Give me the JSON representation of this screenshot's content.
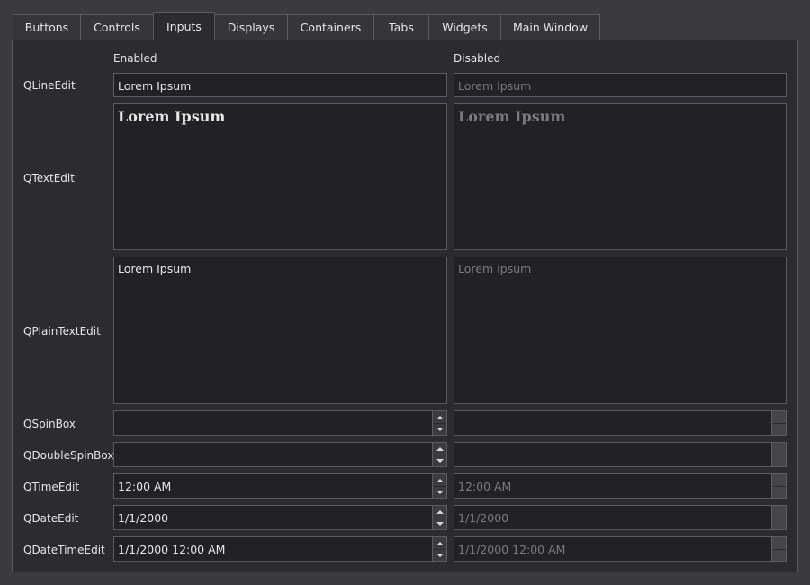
{
  "tabs": [
    "Buttons",
    "Controls",
    "Inputs",
    "Displays",
    "Containers",
    "Tabs",
    "Widgets",
    "Main Window"
  ],
  "active_tab": "Inputs",
  "columns": {
    "enabled": "Enabled",
    "disabled": "Disabled"
  },
  "rows": {
    "lineedit": {
      "label": "QLineEdit",
      "enabled": "Lorem Ipsum",
      "disabled": "Lorem Ipsum"
    },
    "textedit": {
      "label": "QTextEdit",
      "enabled": "Lorem Ipsum",
      "disabled": "Lorem Ipsum"
    },
    "plaintext": {
      "label": "QPlainTextEdit",
      "enabled": "Lorem Ipsum",
      "disabled": "Lorem Ipsum"
    },
    "spinbox": {
      "label": "QSpinBox",
      "enabled": "",
      "disabled": ""
    },
    "doublespin": {
      "label": "QDoubleSpinBox",
      "enabled": "",
      "disabled": ""
    },
    "timeedit": {
      "label": "QTimeEdit",
      "enabled": "12:00 AM",
      "disabled": "12:00 AM"
    },
    "dateedit": {
      "label": "QDateEdit",
      "enabled": "1/1/2000",
      "disabled": "1/1/2000"
    },
    "datetimeedit": {
      "label": "QDateTimeEdit",
      "enabled": "1/1/2000 12:00 AM",
      "disabled": "1/1/2000 12:00 AM"
    }
  },
  "colors": {
    "background": "#3a3b40",
    "pane": "#2b2c31",
    "field": "#212226",
    "border": "#5a5c63",
    "text": "#e6e6e6",
    "disabled_text": "#7a7b80"
  }
}
